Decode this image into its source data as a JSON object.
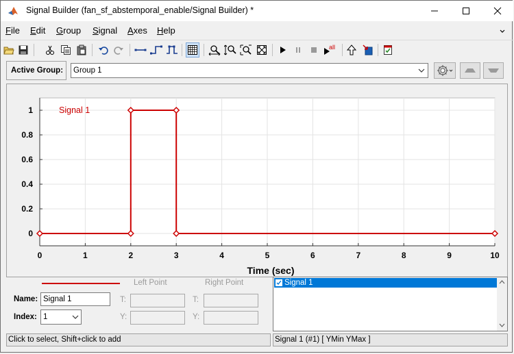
{
  "window": {
    "title": "Signal Builder (fan_sf_abstemporal_enable/Signal Builder) *",
    "minimize_icon": "minimize-icon",
    "maximize_icon": "maximize-icon",
    "close_icon": "close-icon"
  },
  "menu": {
    "items": [
      "File",
      "Edit",
      "Group",
      "Signal",
      "Axes",
      "Help"
    ],
    "mnemonics": [
      "F",
      "E",
      "G",
      "S",
      "A",
      "H"
    ]
  },
  "toolbar": {
    "icons": [
      "open-icon",
      "save-icon",
      "cut-icon",
      "copy-icon",
      "paste-icon",
      "undo-icon",
      "redo-icon",
      "line-segment-icon",
      "step-up-icon",
      "pulse-icon",
      "grid-icon",
      "zoom-x-icon",
      "zoom-y-icon",
      "zoom-xy-icon",
      "fit-view-icon",
      "play-icon",
      "pause-icon",
      "stop-icon",
      "play-all-icon",
      "up-arrow-icon",
      "go-to-model-icon",
      "help-icon"
    ],
    "play_all_label": "all"
  },
  "group": {
    "label": "Active Group:",
    "selected": "Group 1"
  },
  "chart_data": {
    "type": "line",
    "series": [
      {
        "name": "Signal 1",
        "x": [
          0,
          2,
          2,
          3,
          3,
          10
        ],
        "y": [
          0,
          0,
          1,
          1,
          0,
          0
        ],
        "color": "#cc0000"
      }
    ],
    "xlabel": "Time (sec)",
    "ylabel": "",
    "xlim": [
      0,
      10
    ],
    "ylim": [
      -0.1,
      1.1
    ],
    "xticks": [
      "0",
      "1",
      "2",
      "3",
      "4",
      "5",
      "6",
      "7",
      "8",
      "9",
      "10"
    ],
    "yticks": [
      "0",
      "0.2",
      "0.4",
      "0.6",
      "0.8",
      "1"
    ],
    "grid": true
  },
  "bottom": {
    "left_point": "Left Point",
    "right_point": "Right Point",
    "name_label": "Name:",
    "name_value": "Signal 1",
    "index_label": "Index:",
    "index_value": "1",
    "t_label": "T:",
    "y_label": "Y:",
    "signal_list": [
      "Signal 1"
    ],
    "line_color": "#cc0000"
  },
  "status": {
    "left": "Click to select, Shift+click to add",
    "right": "Signal 1 (#1)  [ YMin YMax ]"
  }
}
